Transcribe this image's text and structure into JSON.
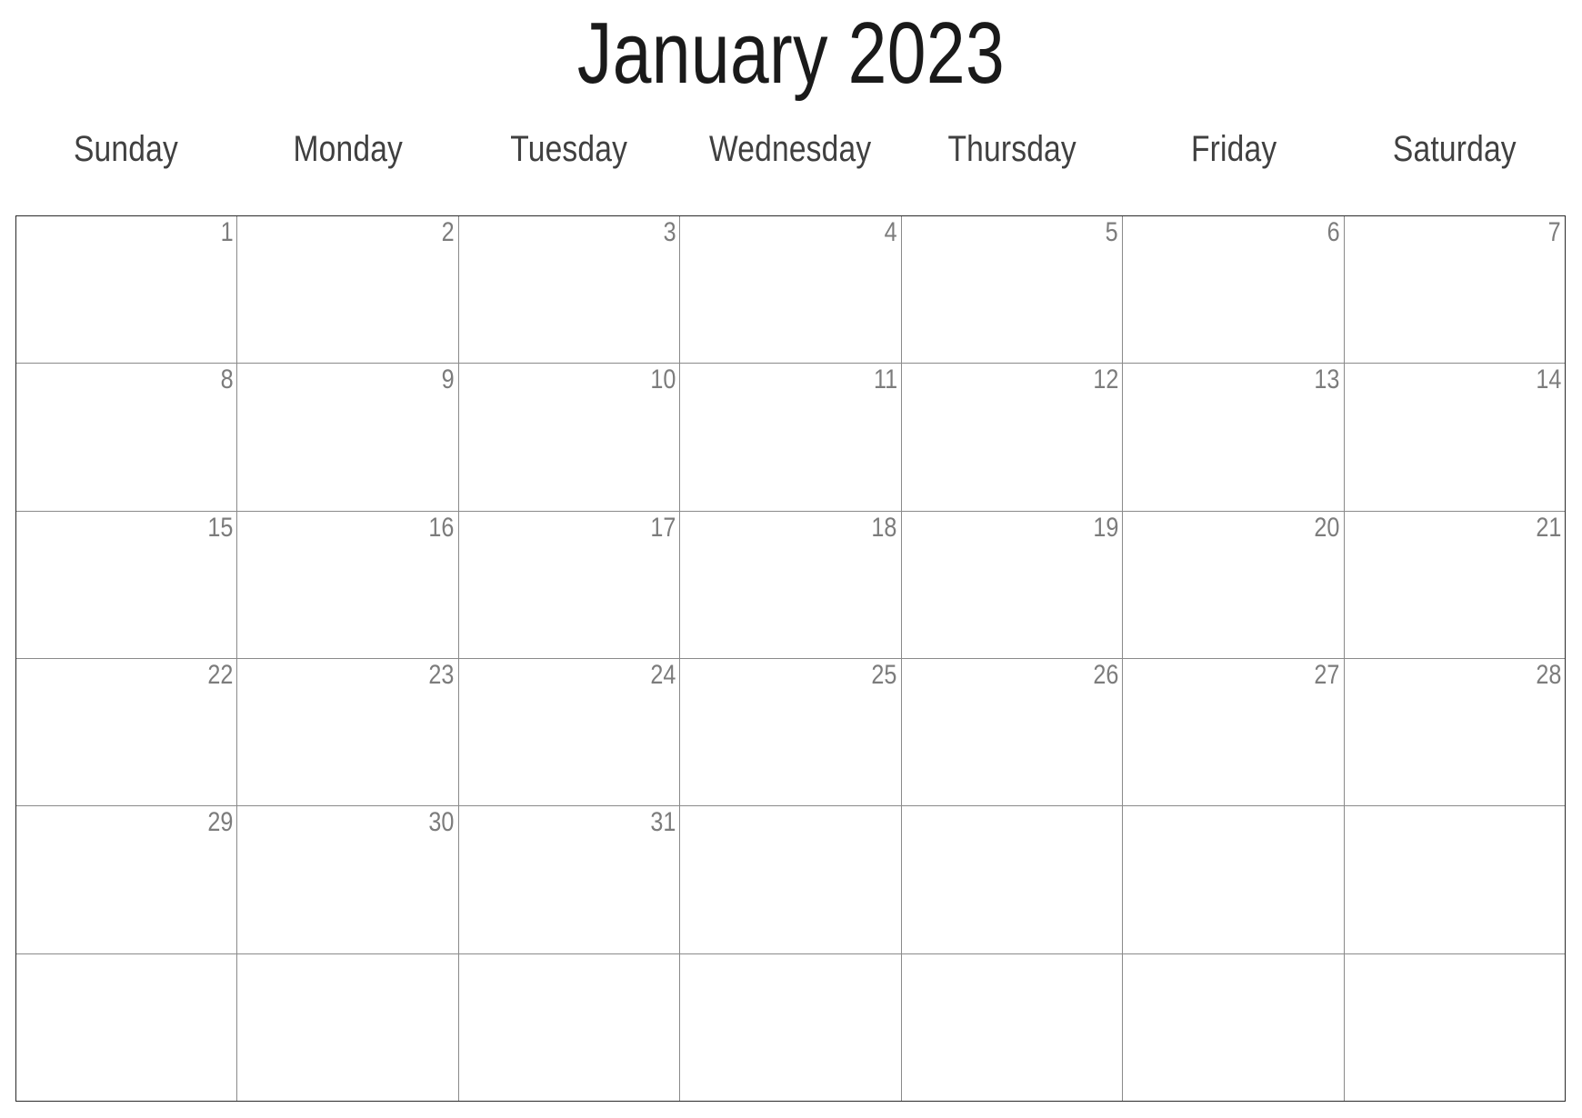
{
  "calendar": {
    "title": "January 2023",
    "month": "January",
    "year": "2023",
    "weekdays": [
      {
        "label": "Sunday"
      },
      {
        "label": "Monday"
      },
      {
        "label": "Tuesday"
      },
      {
        "label": "Wednesday"
      },
      {
        "label": "Thursday"
      },
      {
        "label": "Friday"
      },
      {
        "label": "Saturday"
      }
    ],
    "weeks": [
      {
        "days": [
          {
            "number": "1"
          },
          {
            "number": "2"
          },
          {
            "number": "3"
          },
          {
            "number": "4"
          },
          {
            "number": "5"
          },
          {
            "number": "6"
          },
          {
            "number": "7"
          }
        ]
      },
      {
        "days": [
          {
            "number": "8"
          },
          {
            "number": "9"
          },
          {
            "number": "10"
          },
          {
            "number": "11"
          },
          {
            "number": "12"
          },
          {
            "number": "13"
          },
          {
            "number": "14"
          }
        ]
      },
      {
        "days": [
          {
            "number": "15"
          },
          {
            "number": "16"
          },
          {
            "number": "17"
          },
          {
            "number": "18"
          },
          {
            "number": "19"
          },
          {
            "number": "20"
          },
          {
            "number": "21"
          }
        ]
      },
      {
        "days": [
          {
            "number": "22"
          },
          {
            "number": "23"
          },
          {
            "number": "24"
          },
          {
            "number": "25"
          },
          {
            "number": "26"
          },
          {
            "number": "27"
          },
          {
            "number": "28"
          }
        ]
      },
      {
        "days": [
          {
            "number": "29"
          },
          {
            "number": "30"
          },
          {
            "number": "31"
          },
          {
            "number": ""
          },
          {
            "number": ""
          },
          {
            "number": ""
          },
          {
            "number": ""
          }
        ]
      },
      {
        "days": [
          {
            "number": ""
          },
          {
            "number": ""
          },
          {
            "number": ""
          },
          {
            "number": ""
          },
          {
            "number": ""
          },
          {
            "number": ""
          },
          {
            "number": ""
          }
        ]
      }
    ],
    "colors": {
      "title_text": "#1a1a1a",
      "weekday_text": "#404040",
      "day_number_text": "#7c7c7c",
      "grid_outer_border": "#2a2a2a",
      "grid_inner_border": "#8a8a8a",
      "background": "#ffffff"
    }
  }
}
